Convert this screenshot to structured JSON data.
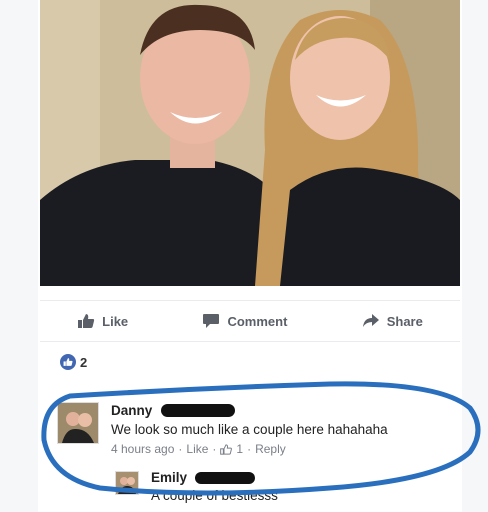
{
  "actions": {
    "like_label": "Like",
    "comment_label": "Comment",
    "share_label": "Share"
  },
  "reactions": {
    "count": "2"
  },
  "comment": {
    "author": "Danny",
    "text": "We look so much like a couple here hahahaha",
    "time": "4 hours ago",
    "like_link": "Like",
    "like_count": "1",
    "reply_link": "Reply",
    "separator": "·"
  },
  "reply": {
    "author": "Emily",
    "text": "A couple of bestiesss"
  },
  "colors": {
    "facebook_blue": "#4267b2",
    "circle_blue": "#2a6fbd"
  }
}
